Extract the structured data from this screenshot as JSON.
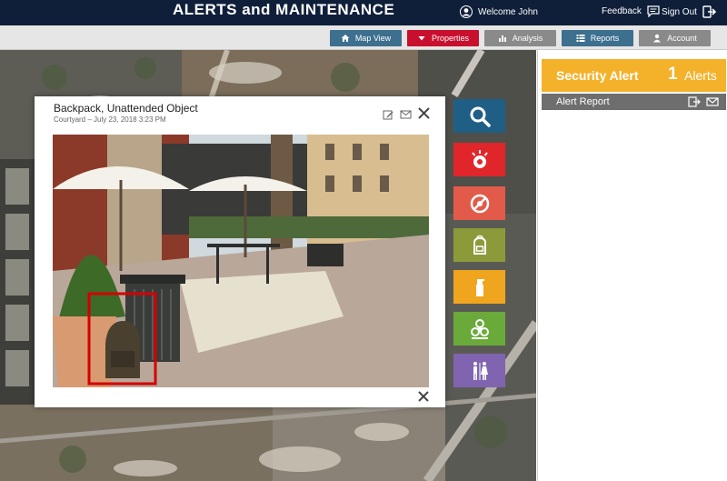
{
  "header": {
    "title": "ALERTS and MAINTENANCE",
    "welcome": "Welcome John",
    "feedback": "Feedback",
    "signout": "Sign Out",
    "bg_color": "#0f1f3a"
  },
  "nav": {
    "items": [
      {
        "label": "Map View",
        "color": "#3d6f8e",
        "icon": "home-icon"
      },
      {
        "label": "Properties",
        "color": "#c8102e",
        "icon": "caret-down-icon"
      },
      {
        "label": "Analysis",
        "color": "#8a8a8a",
        "icon": "bar-chart-icon"
      },
      {
        "label": "Reports",
        "color": "#3d6f8e",
        "icon": "list-icon"
      },
      {
        "label": "Account",
        "color": "#8a8a8a",
        "icon": "user-icon"
      }
    ]
  },
  "panel": {
    "alert_title": "Security Alert",
    "alert_count": "1",
    "alert_label": "Alerts",
    "alert_color": "#f4b12a",
    "report_label": "Alert Report"
  },
  "popup": {
    "title": "Backpack, Unattended Object",
    "subtitle": "Courtyard – July 23, 2018 3:23 PM",
    "highlight_color": "#d40000"
  },
  "categories": [
    {
      "name": "search",
      "color": "#1f5f86",
      "icon": "search-icon"
    },
    {
      "name": "alarm",
      "color": "#e0262b",
      "icon": "alarm-light-icon"
    },
    {
      "name": "prohibited",
      "color": "#e25b4a",
      "icon": "no-entry-icon"
    },
    {
      "name": "backpack",
      "color": "#8c9a3a",
      "icon": "backpack-icon"
    },
    {
      "name": "spill",
      "color": "#f0a51f",
      "icon": "spray-bottle-icon"
    },
    {
      "name": "biohazard",
      "color": "#6aaa3a",
      "icon": "biohazard-icon"
    },
    {
      "name": "restroom",
      "color": "#8064b0",
      "icon": "restroom-icon"
    }
  ]
}
